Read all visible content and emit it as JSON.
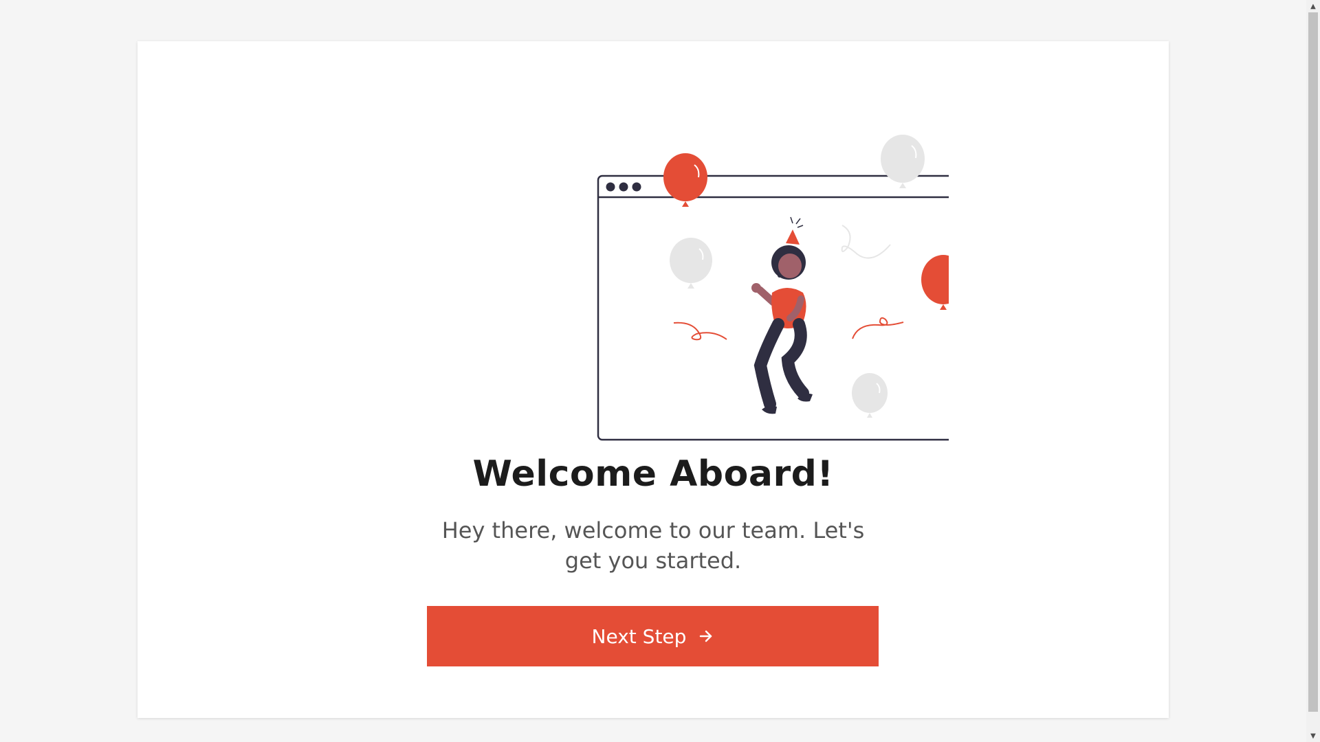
{
  "welcome": {
    "heading": "Welcome Aboard!",
    "subtext": "Hey there, welcome to our team. Let's get you started."
  },
  "cta": {
    "label": "Next Step",
    "icon": "arrow-right-icon"
  },
  "illustration": {
    "subject": "celebration-illustration",
    "icons": [
      "browser-window",
      "balloon-icon",
      "confetti-streamer",
      "party-person"
    ]
  },
  "colors": {
    "accent": "#e44d36",
    "balloon_gray": "#e6e6e6",
    "outline": "#2f2e41",
    "heading": "#1c1c1c",
    "subtext": "#555555",
    "background": "#f5f5f5"
  }
}
